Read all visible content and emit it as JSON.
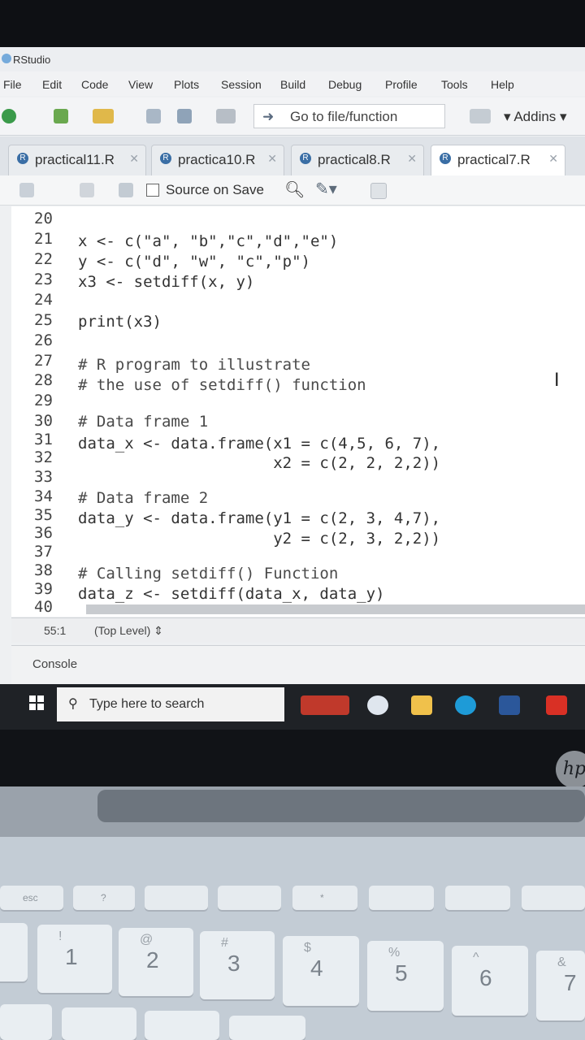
{
  "window": {
    "title": "RStudio"
  },
  "menu": [
    "File",
    "Edit",
    "Code",
    "View",
    "Plots",
    "Session",
    "Build",
    "Debug",
    "Profile",
    "Tools",
    "Help"
  ],
  "toolbar": {
    "goto_label": "Go to file/function",
    "addins_label": "Addins"
  },
  "tabs": [
    {
      "label": "practical11.R",
      "active": false
    },
    {
      "label": "practica10.R",
      "active": false
    },
    {
      "label": "practical8.R",
      "active": false
    },
    {
      "label": "practical7.R",
      "active": true
    }
  ],
  "editor_toolbar": {
    "source_on_save": "Source on Save"
  },
  "code_lines": [
    {
      "n": "20",
      "text": ""
    },
    {
      "n": "21",
      "text": "x <- c(\"a\", \"b\",\"c\",\"d\",\"e\")"
    },
    {
      "n": "22",
      "text": "y <- c(\"d\", \"w\", \"c\",\"p\")"
    },
    {
      "n": "23",
      "text": "x3 <- setdiff(x, y)"
    },
    {
      "n": "24",
      "text": ""
    },
    {
      "n": "25",
      "text": "print(x3)"
    },
    {
      "n": "26",
      "text": ""
    },
    {
      "n": "27",
      "text": "# R program to illustrate"
    },
    {
      "n": "28",
      "text": "# the use of setdiff() function"
    },
    {
      "n": "29",
      "text": ""
    },
    {
      "n": "30",
      "text": "# Data frame 1"
    },
    {
      "n": "31",
      "text": "data_x <- data.frame(x1 = c(4,5, 6, 7),"
    },
    {
      "n": "32",
      "text": "                     x2 = c(2, 2, 2,2))"
    },
    {
      "n": "33",
      "text": ""
    },
    {
      "n": "34",
      "text": "# Data frame 2"
    },
    {
      "n": "35",
      "text": "data_y <- data.frame(y1 = c(2, 3, 4,7),"
    },
    {
      "n": "36",
      "text": "                     y2 = c(2, 3, 2,2))"
    },
    {
      "n": "37",
      "text": ""
    },
    {
      "n": "38",
      "text": "# Calling setdiff() Function"
    },
    {
      "n": "39",
      "text": "data_z <- setdiff(data_x, data_y)"
    },
    {
      "n": "40",
      "text": ""
    }
  ],
  "status": {
    "position": "55:1",
    "scope": "(Top Level)"
  },
  "console": {
    "label": "Console"
  },
  "taskbar": {
    "search_placeholder": "Type here to search"
  },
  "keyboard": {
    "fn_row": [
      "esc",
      "?",
      "",
      "",
      "",
      "*",
      "",
      "",
      ""
    ],
    "num_row": [
      {
        "main": "1",
        "shift": "!"
      },
      {
        "main": "2",
        "shift": "@"
      },
      {
        "main": "3",
        "shift": "#"
      },
      {
        "main": "4",
        "shift": "$"
      },
      {
        "main": "5",
        "shift": "%"
      },
      {
        "main": "6",
        "shift": "^"
      },
      {
        "main": "7",
        "shift": "&"
      }
    ]
  },
  "brand": "hp"
}
